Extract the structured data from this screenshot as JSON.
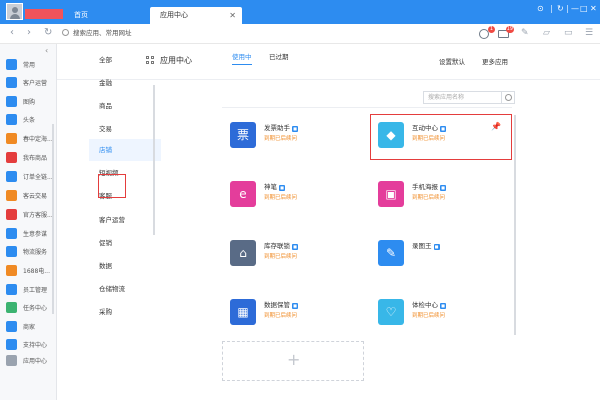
{
  "titlebar": {
    "tabs": [
      {
        "label": "首页"
      },
      {
        "label": "应用中心"
      }
    ],
    "window_controls": [
      "⊙",
      "↻",
      "—",
      "□",
      "✕"
    ]
  },
  "addressbar": {
    "url_placeholder": "搜索应用、常用网址",
    "notif_count_1": "1",
    "notif_count_2": "19"
  },
  "sidebar": {
    "items": [
      {
        "label": "常用",
        "color": "#2d8cf0"
      },
      {
        "label": "客户运营",
        "color": "#2d8cf0"
      },
      {
        "label": "图购",
        "color": "#2d8cf0"
      },
      {
        "label": "头条",
        "color": "#2d8cf0"
      },
      {
        "label": "春中定海...",
        "color": "#f08a24"
      },
      {
        "label": "我布商品",
        "color": "#e43d3d"
      },
      {
        "label": "订单全链...",
        "color": "#2d8cf0"
      },
      {
        "label": "客云交易",
        "color": "#f08a24"
      },
      {
        "label": "官方客服...",
        "color": "#e43d3d"
      },
      {
        "label": "生意参谋",
        "color": "#2d8cf0"
      },
      {
        "label": "物流服务",
        "color": "#2d8cf0"
      },
      {
        "label": "1688电...",
        "color": "#f08a24"
      },
      {
        "label": "员工管理",
        "color": "#2d8cf0"
      },
      {
        "label": "任务中心",
        "color": "#3cb371"
      },
      {
        "label": "商家",
        "color": "#2d8cf0"
      },
      {
        "label": "支持中心",
        "color": "#2d8cf0"
      }
    ],
    "footer_label": "应用中心"
  },
  "main": {
    "title": "应用中心",
    "settings_default": "设置默认",
    "more_apps": "更多应用",
    "categories": [
      "全部",
      "金融",
      "商品",
      "交易",
      "店铺",
      "短视频",
      "客服",
      "客户运营",
      "促销",
      "数据",
      "仓储物流",
      "采购"
    ],
    "active_category": "店铺",
    "sub_tabs": [
      "使用中",
      "已过期"
    ],
    "search_placeholder": "搜索应用名称",
    "apps": [
      {
        "name": "发票助手",
        "status": "到期已后续问",
        "icon_color": "#2d6bd8",
        "icon": "票"
      },
      {
        "name": "互动中心",
        "status": "到期已后续问",
        "icon_color": "#38b7e8",
        "icon": "◆"
      },
      {
        "name": "神笔",
        "status": "到期已后续问",
        "icon_color": "#e43d9b",
        "icon": "e"
      },
      {
        "name": "手机海报",
        "status": "到期已后续问",
        "icon_color": "#e43d9b",
        "icon": "▣"
      },
      {
        "name": "库存联锁",
        "status": "到期已后续问",
        "icon_color": "#596b86",
        "icon": "⌂"
      },
      {
        "name": "录图王",
        "status": "",
        "icon_color": "#2d8cf0",
        "icon": "✎"
      },
      {
        "name": "数据保管",
        "status": "到期已后续问",
        "icon_color": "#2d6bd8",
        "icon": "▦"
      },
      {
        "name": "体检中心",
        "status": "到期已后续问",
        "icon_color": "#38b7e8",
        "icon": "♡"
      }
    ]
  }
}
